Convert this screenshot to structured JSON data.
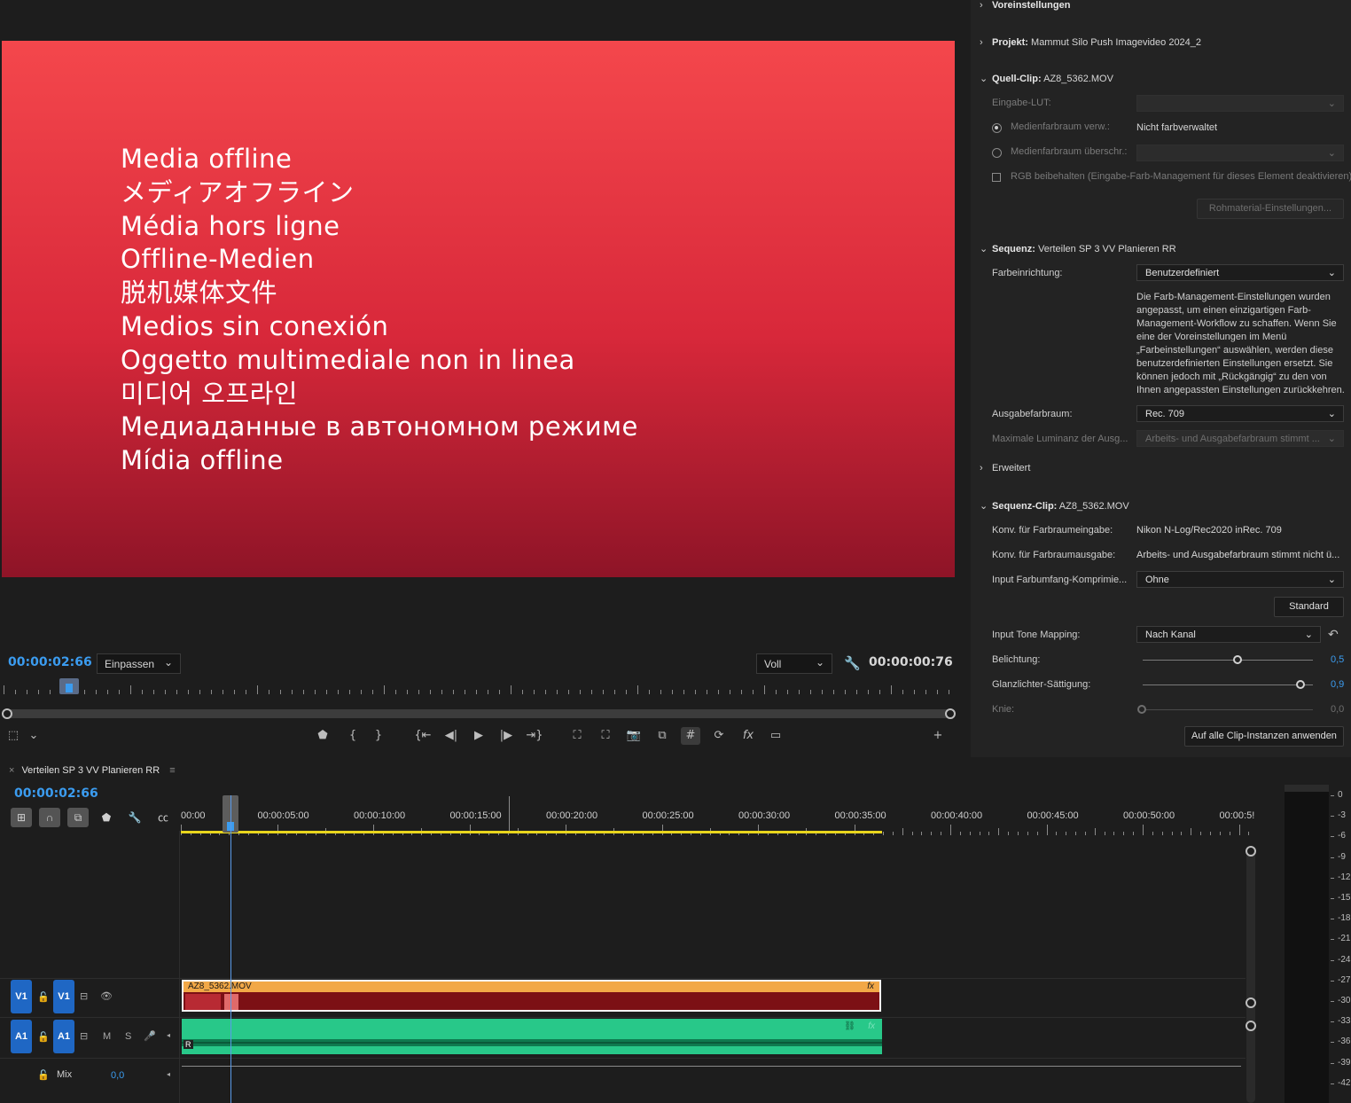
{
  "monitor": {
    "offline_lines": [
      "Media offline",
      "メディアオフライン",
      "Média hors ligne",
      "Offline-Medien",
      "脱机媒体文件",
      "Medios sin conexión",
      "Oggetto multimediale non in linea",
      "미디어 오프라인",
      "Медиаданные в автономном режиме",
      "Mídia offline"
    ],
    "timecode_current": "00:00:02:66",
    "fit_select": "Einpassen",
    "quality_select": "Voll",
    "timecode_duration": "00:00:00:76"
  },
  "lumetri": {
    "presets_label": "Voreinstellungen",
    "project_label": "Projekt:",
    "project_value": "Mammut Silo Push Imagevideo 2024_2",
    "source_clip_label": "Quell-Clip:",
    "source_clip_value": "AZ8_5362.MOV",
    "input_lut_label": "Eingabe-LUT:",
    "media_colorspace_use_label": "Medienfarbraum verw.:",
    "media_colorspace_use_value": "Nicht farbverwaltet",
    "media_colorspace_override_label": "Medienfarbraum überschr.:",
    "rgb_keep_label": "RGB beibehalten (Eingabe-Farb-Management für dieses Element deaktivieren)",
    "raw_settings_button": "Rohmaterial-Einstellungen...",
    "sequence_label": "Sequenz:",
    "sequence_value": "Verteilen SP 3 VV Planieren RR",
    "color_setup_label": "Farbeinrichtung:",
    "color_setup_value": "Benutzerdefiniert",
    "color_setup_note": "Die Farb-Management-Einstellungen wurden angepasst, um einen einzigartigen Farb-Management-Workflow zu schaffen. Wenn Sie eine der Voreinstellungen im Menü „Farbeinstellungen“ auswählen, werden diese benutzerdefinierten Einstellungen ersetzt. Sie können jedoch mit „Rückgängig“ zu den von Ihnen angepassten Einstellungen zurückkehren.",
    "output_colorspace_label": "Ausgabefarbraum:",
    "output_colorspace_value": "Rec. 709",
    "max_luminance_label": "Maximale Luminanz der Ausg...",
    "max_luminance_value": "Arbeits- und Ausgabefarbraum stimmt ...",
    "advanced_label": "Erweitert",
    "sequence_clip_label": "Sequenz-Clip:",
    "sequence_clip_value": "AZ8_5362.MOV",
    "conv_input_label": "Konv. für Farbraumeingabe:",
    "conv_input_value": "Nikon N-Log/Rec2020 inRec. 709",
    "conv_output_label": "Konv. für Farbraumausgabe:",
    "conv_output_value": "Arbeits- und Ausgabefarbraum stimmt nicht ü...",
    "input_gamut_label": "Input Farbumfang-Komprimie...",
    "input_gamut_value": "Ohne",
    "standard_button": "Standard",
    "tone_mapping_label": "Input Tone Mapping:",
    "tone_mapping_value": "Nach Kanal",
    "exposure_label": "Belichtung:",
    "exposure_value": "0,5",
    "highlight_sat_label": "Glanzlichter-Sättigung:",
    "highlight_sat_value": "0,9",
    "knee_label": "Knie:",
    "knee_value": "0,0",
    "apply_all_button": "Auf alle Clip-Instanzen anwenden"
  },
  "timeline": {
    "sequence_tab": "Verteilen SP 3 VV Planieren RR",
    "timecode": "00:00:02:66",
    "ruler_labels": [
      "00:00",
      "00:00:05:00",
      "00:00:10:00",
      "00:00:15:00",
      "00:00:20:00",
      "00:00:25:00",
      "00:00:30:00",
      "00:00:35:00",
      "00:00:40:00",
      "00:00:45:00",
      "00:00:50:00",
      "00:00:5!"
    ],
    "tracks": {
      "v1_left": "V1",
      "v1_right": "V1",
      "a1_left": "A1",
      "a1_right": "A1",
      "a1_m": "M",
      "a1_s": "S",
      "mix_label": "Mix",
      "mix_value": "0,0"
    },
    "clip_video_name": "AZ8_5362.MOV",
    "clip_fx": "fx",
    "clip_audio_r": "R"
  },
  "meter": {
    "labels": [
      "0",
      "-3",
      "-6",
      "-9",
      "-12",
      "-15",
      "-18",
      "-21",
      "-24",
      "-27",
      "-30",
      "-33",
      "-36",
      "-39",
      "-42"
    ]
  }
}
